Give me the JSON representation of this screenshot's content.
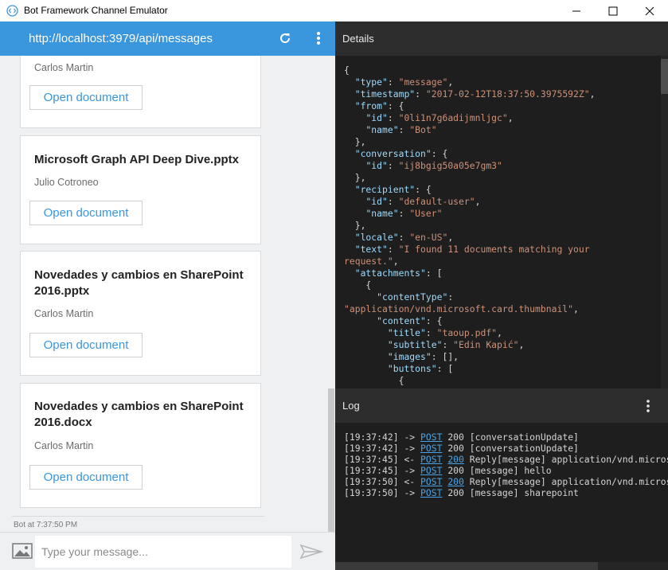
{
  "window": {
    "title": "Bot Framework Channel Emulator",
    "accent": "#3a96dd"
  },
  "address": {
    "url": "http://localhost:3979/api/messages",
    "refresh_icon": "refresh-icon",
    "menu_icon": "vertical-dots-icon"
  },
  "cards": [
    {
      "title": "",
      "subtitle": "Carlos Martin",
      "button": "Open document"
    },
    {
      "title": "Microsoft Graph API Deep Dive.pptx",
      "subtitle": "Julio Cotroneo",
      "button": "Open document"
    },
    {
      "title": "Novedades y cambios en SharePoint 2016.pptx",
      "subtitle": "Carlos Martin",
      "button": "Open document"
    },
    {
      "title": "Novedades y cambios en SharePoint 2016.docx",
      "subtitle": "Carlos Martin",
      "button": "Open document"
    }
  ],
  "chat": {
    "timestamp": "Bot at 7:37:50 PM",
    "placeholder": "Type your message..."
  },
  "details": {
    "header": "Details",
    "lines": [
      [
        [
          "p",
          "{"
        ]
      ],
      [
        [
          "p",
          "  "
        ],
        [
          "k",
          "\"type\""
        ],
        [
          "p",
          ": "
        ],
        [
          "s",
          "\"message\""
        ],
        [
          "p",
          ","
        ]
      ],
      [
        [
          "p",
          "  "
        ],
        [
          "k",
          "\"timestamp\""
        ],
        [
          "p",
          ": "
        ],
        [
          "s",
          "\"2017-02-12T18:37:50.3975592Z\""
        ],
        [
          "p",
          ","
        ]
      ],
      [
        [
          "p",
          "  "
        ],
        [
          "k",
          "\"from\""
        ],
        [
          "p",
          ": {"
        ]
      ],
      [
        [
          "p",
          "    "
        ],
        [
          "k",
          "\"id\""
        ],
        [
          "p",
          ": "
        ],
        [
          "s",
          "\"0li1n7g6adijmnljgc\""
        ],
        [
          "p",
          ","
        ]
      ],
      [
        [
          "p",
          "    "
        ],
        [
          "k",
          "\"name\""
        ],
        [
          "p",
          ": "
        ],
        [
          "s",
          "\"Bot\""
        ]
      ],
      [
        [
          "p",
          "  },"
        ]
      ],
      [
        [
          "p",
          "  "
        ],
        [
          "k",
          "\"conversation\""
        ],
        [
          "p",
          ": {"
        ]
      ],
      [
        [
          "p",
          "    "
        ],
        [
          "k",
          "\"id\""
        ],
        [
          "p",
          ": "
        ],
        [
          "s",
          "\"ij8bgig50a05e7gm3\""
        ]
      ],
      [
        [
          "p",
          "  },"
        ]
      ],
      [
        [
          "p",
          "  "
        ],
        [
          "k",
          "\"recipient\""
        ],
        [
          "p",
          ": {"
        ]
      ],
      [
        [
          "p",
          "    "
        ],
        [
          "k",
          "\"id\""
        ],
        [
          "p",
          ": "
        ],
        [
          "s",
          "\"default-user\""
        ],
        [
          "p",
          ","
        ]
      ],
      [
        [
          "p",
          "    "
        ],
        [
          "k",
          "\"name\""
        ],
        [
          "p",
          ": "
        ],
        [
          "s",
          "\"User\""
        ]
      ],
      [
        [
          "p",
          "  },"
        ]
      ],
      [
        [
          "p",
          "  "
        ],
        [
          "k",
          "\"locale\""
        ],
        [
          "p",
          ": "
        ],
        [
          "s",
          "\"en-US\""
        ],
        [
          "p",
          ","
        ]
      ],
      [
        [
          "p",
          "  "
        ],
        [
          "k",
          "\"text\""
        ],
        [
          "p",
          ": "
        ],
        [
          "s",
          "\"I found 11 documents matching your"
        ]
      ],
      [
        [
          "s",
          "request.\""
        ],
        [
          "p",
          ","
        ]
      ],
      [
        [
          "p",
          "  "
        ],
        [
          "k",
          "\"attachments\""
        ],
        [
          "p",
          ": ["
        ]
      ],
      [
        [
          "p",
          "    {"
        ]
      ],
      [
        [
          "p",
          "      "
        ],
        [
          "k",
          "\"contentType\""
        ],
        [
          "p",
          ":"
        ]
      ],
      [
        [
          "s",
          "\"application/vnd.microsoft.card.thumbnail\""
        ],
        [
          "p",
          ","
        ]
      ],
      [
        [
          "p",
          "      "
        ],
        [
          "k",
          "\"content\""
        ],
        [
          "p",
          ": {"
        ]
      ],
      [
        [
          "p",
          "        "
        ],
        [
          "k",
          "\"title\""
        ],
        [
          "p",
          ": "
        ],
        [
          "s",
          "\"taoup.pdf\""
        ],
        [
          "p",
          ","
        ]
      ],
      [
        [
          "p",
          "        "
        ],
        [
          "k",
          "\"subtitle\""
        ],
        [
          "p",
          ": "
        ],
        [
          "s",
          "\"Edin Kapić\""
        ],
        [
          "p",
          ","
        ]
      ],
      [
        [
          "p",
          "        "
        ],
        [
          "k",
          "\"images\""
        ],
        [
          "p",
          ": [],"
        ]
      ],
      [
        [
          "p",
          "        "
        ],
        [
          "k",
          "\"buttons\""
        ],
        [
          "p",
          ": ["
        ]
      ],
      [
        [
          "p",
          "          {"
        ]
      ]
    ]
  },
  "log": {
    "header": "Log",
    "menu_icon": "vertical-dots-icon",
    "entries": [
      {
        "time": "[19:37:42]",
        "dir": "->",
        "method": "POST",
        "status": "200",
        "status_link": false,
        "msg": "[conversationUpdate]"
      },
      {
        "time": "[19:37:42]",
        "dir": "->",
        "method": "POST",
        "status": "200",
        "status_link": false,
        "msg": "[conversationUpdate]"
      },
      {
        "time": "[19:37:45]",
        "dir": "<-",
        "method": "POST",
        "status": "200",
        "status_link": true,
        "msg": "Reply[message] application/vnd.microsoft"
      },
      {
        "time": "[19:37:45]",
        "dir": "->",
        "method": "POST",
        "status": "200",
        "status_link": false,
        "msg": "[message] hello"
      },
      {
        "time": "[19:37:50]",
        "dir": "<-",
        "method": "POST",
        "status": "200",
        "status_link": true,
        "msg": "Reply[message] application/vnd.microsoft"
      },
      {
        "time": "[19:37:50]",
        "dir": "->",
        "method": "POST",
        "status": "200",
        "status_link": false,
        "msg": "[message] sharepoint"
      }
    ]
  }
}
